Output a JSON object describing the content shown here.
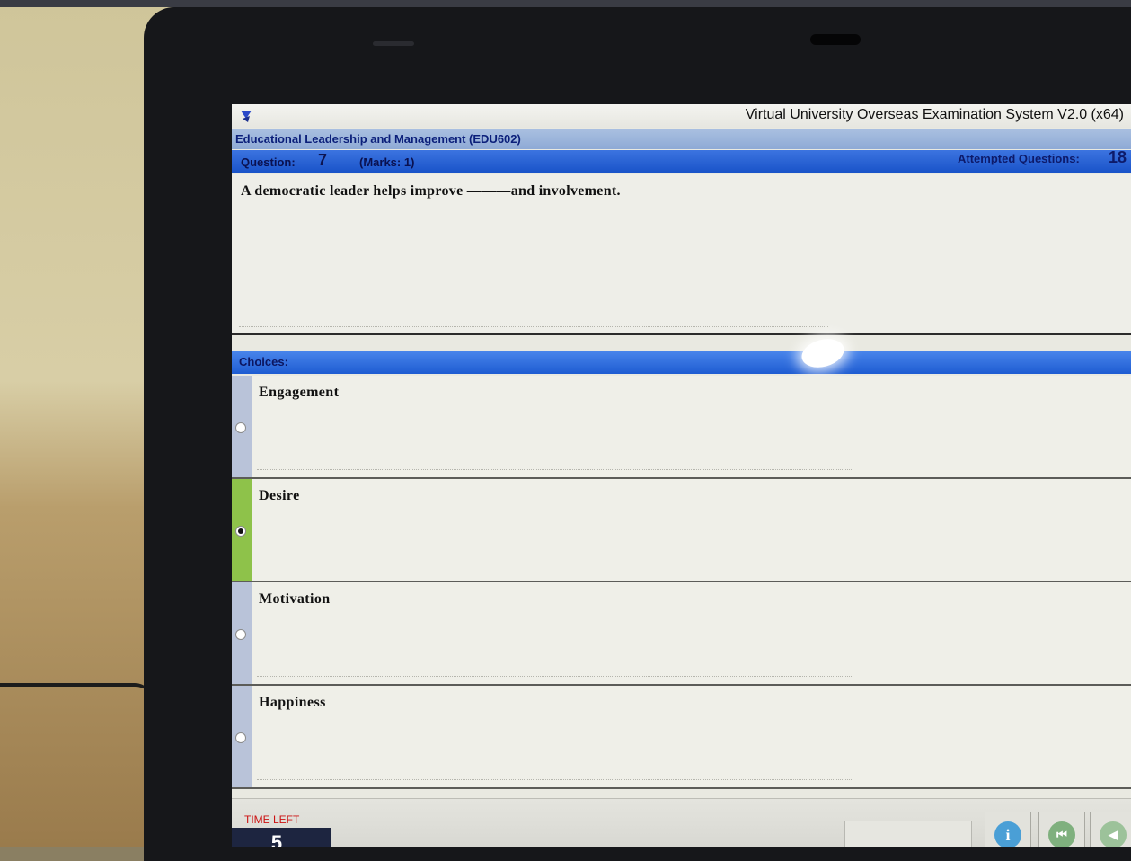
{
  "window": {
    "title": "Virtual University Overseas Examination System  V2.0 (x64)"
  },
  "course": {
    "title": "Educational Leadership and Management  (EDU602)"
  },
  "question": {
    "label": "Question:",
    "number": "7",
    "marks": "(Marks: 1)",
    "attempted_label": "Attempted Questions:",
    "attempted_count": "18",
    "text": "A democratic leader helps improve ———and involvement."
  },
  "choices": {
    "header": "Choices:",
    "items": [
      {
        "label": "Engagement",
        "selected": false
      },
      {
        "label": "Desire",
        "selected": true
      },
      {
        "label": "Motivation",
        "selected": false
      },
      {
        "label": "Happiness",
        "selected": false
      }
    ]
  },
  "footer": {
    "time_left_label": "TIME LEFT",
    "time_left_value": "5",
    "info_glyph": "i",
    "first_glyph": "⏮",
    "prev_glyph": "◀"
  },
  "colors": {
    "question_bar": "#1852c8",
    "course_bar": "#8eaad6",
    "selected_choice": "#8ec24a",
    "time_left": "#cc1111"
  }
}
